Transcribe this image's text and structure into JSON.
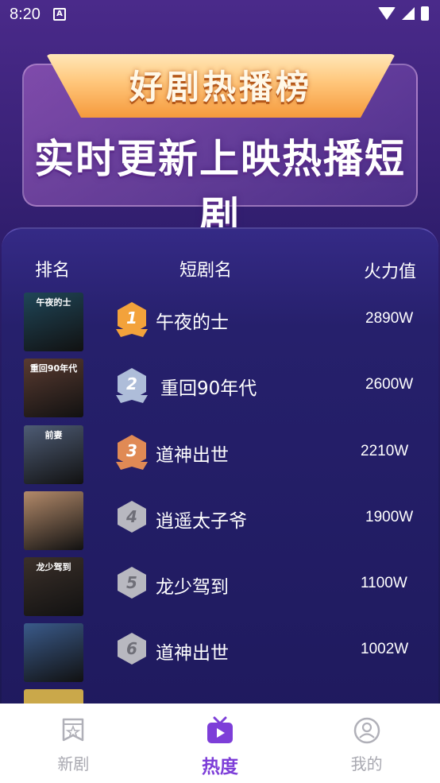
{
  "status_bar": {
    "time": "8:20",
    "notification_icon": "A"
  },
  "banner": {
    "ribbon_title": "好剧热播榜",
    "subtitle": "实时更新上映热播短剧"
  },
  "table": {
    "headers": {
      "rank": "排名",
      "name": "短剧名",
      "heat": "火力值"
    },
    "rows": [
      {
        "rank": "1",
        "thumb_text": "午夜的士",
        "name": "午夜的士",
        "heat": "2890W",
        "badge_color": "#f3a23b",
        "thumb_color": "#1f4658"
      },
      {
        "rank": "2",
        "thumb_text": "重回90年代",
        "name": "重回90年代",
        "heat": "2600W",
        "badge_color": "#aebdd9",
        "thumb_color": "#5a3b31"
      },
      {
        "rank": "3",
        "thumb_text": "前妻",
        "name": "道神出世",
        "heat": "2210W",
        "badge_color": "#e08a55",
        "thumb_color": "#4e5c75"
      },
      {
        "rank": "4",
        "thumb_text": "",
        "name": "逍遥太子爷",
        "heat": "1900W",
        "badge_color": "#b8b8c0",
        "thumb_color": "#b38a6a"
      },
      {
        "rank": "5",
        "thumb_text": "龙少驾到",
        "name": "龙少驾到",
        "heat": "1100W",
        "badge_color": "#b8b8c0",
        "thumb_color": "#3b302a"
      },
      {
        "rank": "6",
        "thumb_text": "",
        "name": "道神出世",
        "heat": "1002W",
        "badge_color": "#b8b8c0",
        "thumb_color": "#3a5a8a"
      }
    ]
  },
  "tabbar": {
    "tabs": [
      {
        "label": "新剧",
        "icon": "badge-star-icon",
        "active": false
      },
      {
        "label": "热度",
        "icon": "tv-icon",
        "active": true
      },
      {
        "label": "我的",
        "icon": "user-circle-icon",
        "active": false
      }
    ]
  },
  "colors": {
    "accent": "#7d3ed8",
    "inactive": "#a8a8b0"
  }
}
